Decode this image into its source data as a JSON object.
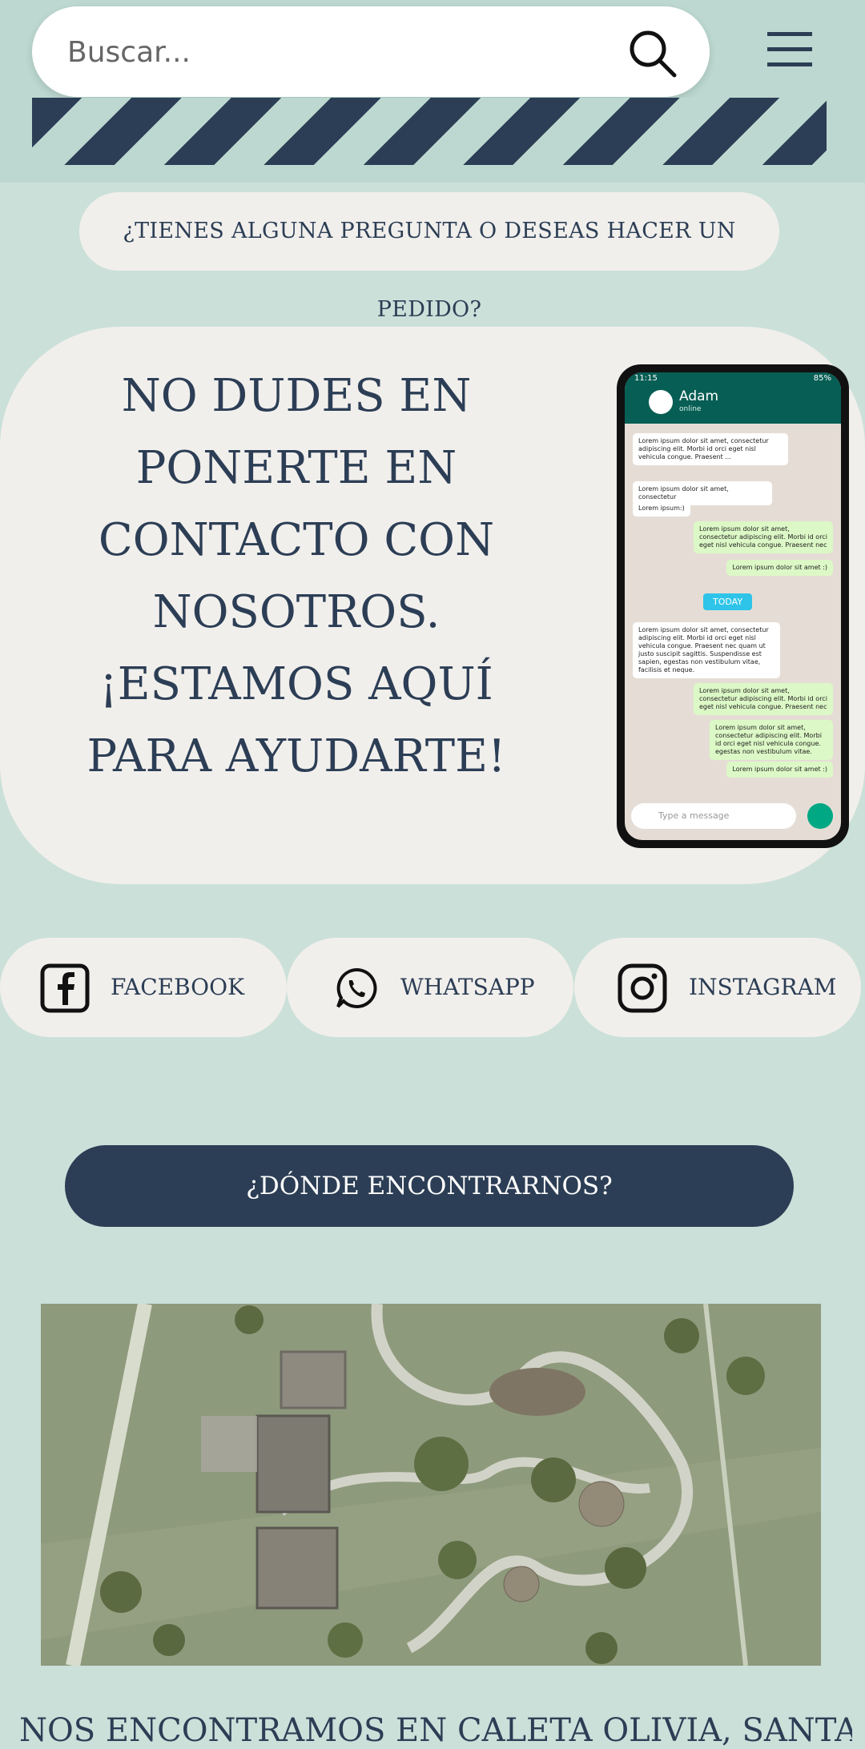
{
  "header": {
    "search_placeholder": "Buscar...",
    "search_icon": "search-icon",
    "menu_icon": "hamburger-menu-icon"
  },
  "question_banner": "¿TIENES ALGUNA PREGUNTA O DESEAS HACER UN PEDIDO?",
  "hero": {
    "lines": [
      "NO DUDES EN",
      "PONERTE EN",
      "CONTACTO CON",
      "NOSOTROS.",
      "¡ESTAMOS AQUÍ",
      "PARA AYUDARTE!"
    ],
    "phone": {
      "status_time": "11:15",
      "status_battery": "85%",
      "contact_name": "Adam",
      "contact_status": "online",
      "messages": [
        {
          "side": "in",
          "text": "Lorem ipsum dolor sit amet, consectetur adipiscing elit. Morbi id orci eget nisl vehicula congue. Praesent ..."
        },
        {
          "side": "in",
          "text": "Lorem ipsum dolor sit amet, consectetur"
        },
        {
          "side": "in",
          "text": "Lorem ipsum:)"
        },
        {
          "side": "out",
          "text": "Lorem ipsum dolor sit amet, consectetur adipiscing elit. Morbi id orci eget nisl vehicula congue. Praesent nec"
        },
        {
          "side": "out",
          "text": "Lorem ipsum dolor sit amet :)"
        },
        {
          "side": "in",
          "text": "Lorem ipsum dolor sit amet, consectetur adipiscing elit. Morbi id orci eget nisl vehicula congue. Praesent nec quam ut justo suscipit sagittis. Suspendisse est sapien, egestas non vestibulum vitae, facilisis et neque."
        },
        {
          "side": "out",
          "text": "Lorem ipsum dolor sit amet, consectetur adipiscing elit. Morbi id orci eget nisl vehicula congue. Praesent nec"
        },
        {
          "side": "out",
          "text": "Lorem ipsum dolor sit amet, consectetur adipiscing elit. Morbi id orci eget nisl vehicula congue. egestas non vestibulum vitae."
        },
        {
          "side": "out",
          "text": "Lorem ipsum dolor sit amet :)"
        }
      ],
      "date_divider": "TODAY",
      "compose_placeholder": "Type a message"
    }
  },
  "social": [
    {
      "label": "FACEBOOK",
      "icon": "facebook-icon"
    },
    {
      "label": "WHATSAPP",
      "icon": "whatsapp-icon"
    },
    {
      "label": "INSTAGRAM",
      "icon": "instagram-icon"
    }
  ],
  "location_button": "¿DÓNDE ENCONTRARNOS?",
  "location_text": "NOS ENCONTRAMOS EN CALETA OLIVIA, SANTA"
}
